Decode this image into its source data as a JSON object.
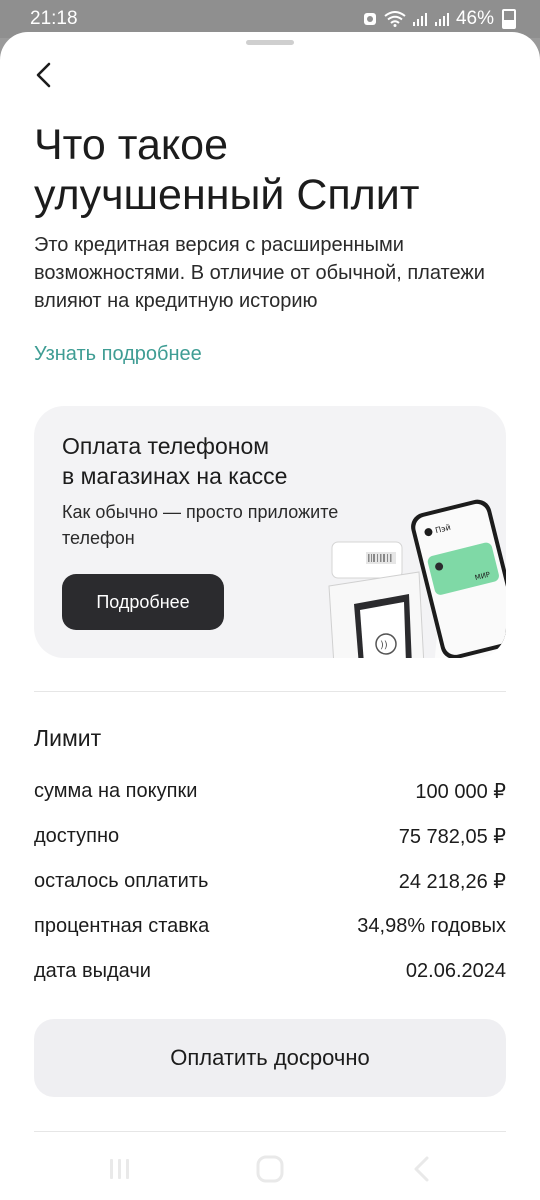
{
  "status_bar": {
    "time": "21:18",
    "battery": "46%"
  },
  "page": {
    "title_line1": "Что такое",
    "title_line2": "улучшенный Сплит",
    "subtitle": "Это кредитная версия с расширенными возможностями. В отличие от обычной, платежи влияют на кредитную историю",
    "more_link": "Узнать подробнее"
  },
  "promo": {
    "title_line1": "Оплата телефоном",
    "title_line2": "в магазинах на кассе",
    "text": "Как обычно — просто приложите телефон",
    "button": "Подробнее",
    "card_brand": "МИР",
    "pay_label": "Пэй"
  },
  "limit": {
    "title": "Лимит",
    "rows": [
      {
        "label": "сумма на покупки",
        "value": "100 000 ₽"
      },
      {
        "label": "доступно",
        "value": "75 782,05 ₽"
      },
      {
        "label": "осталось оплатить",
        "value": "24 218,26 ₽"
      },
      {
        "label": "процентная ставка",
        "value": "34,98% годовых"
      },
      {
        "label": "дата выдачи",
        "value": "02.06.2024"
      }
    ]
  },
  "actions": {
    "pay_early": "Оплатить досрочно"
  },
  "colors": {
    "link": "#3f9d94",
    "dark_button": "#2b2b2e",
    "card_bg": "#f3f3f5"
  }
}
